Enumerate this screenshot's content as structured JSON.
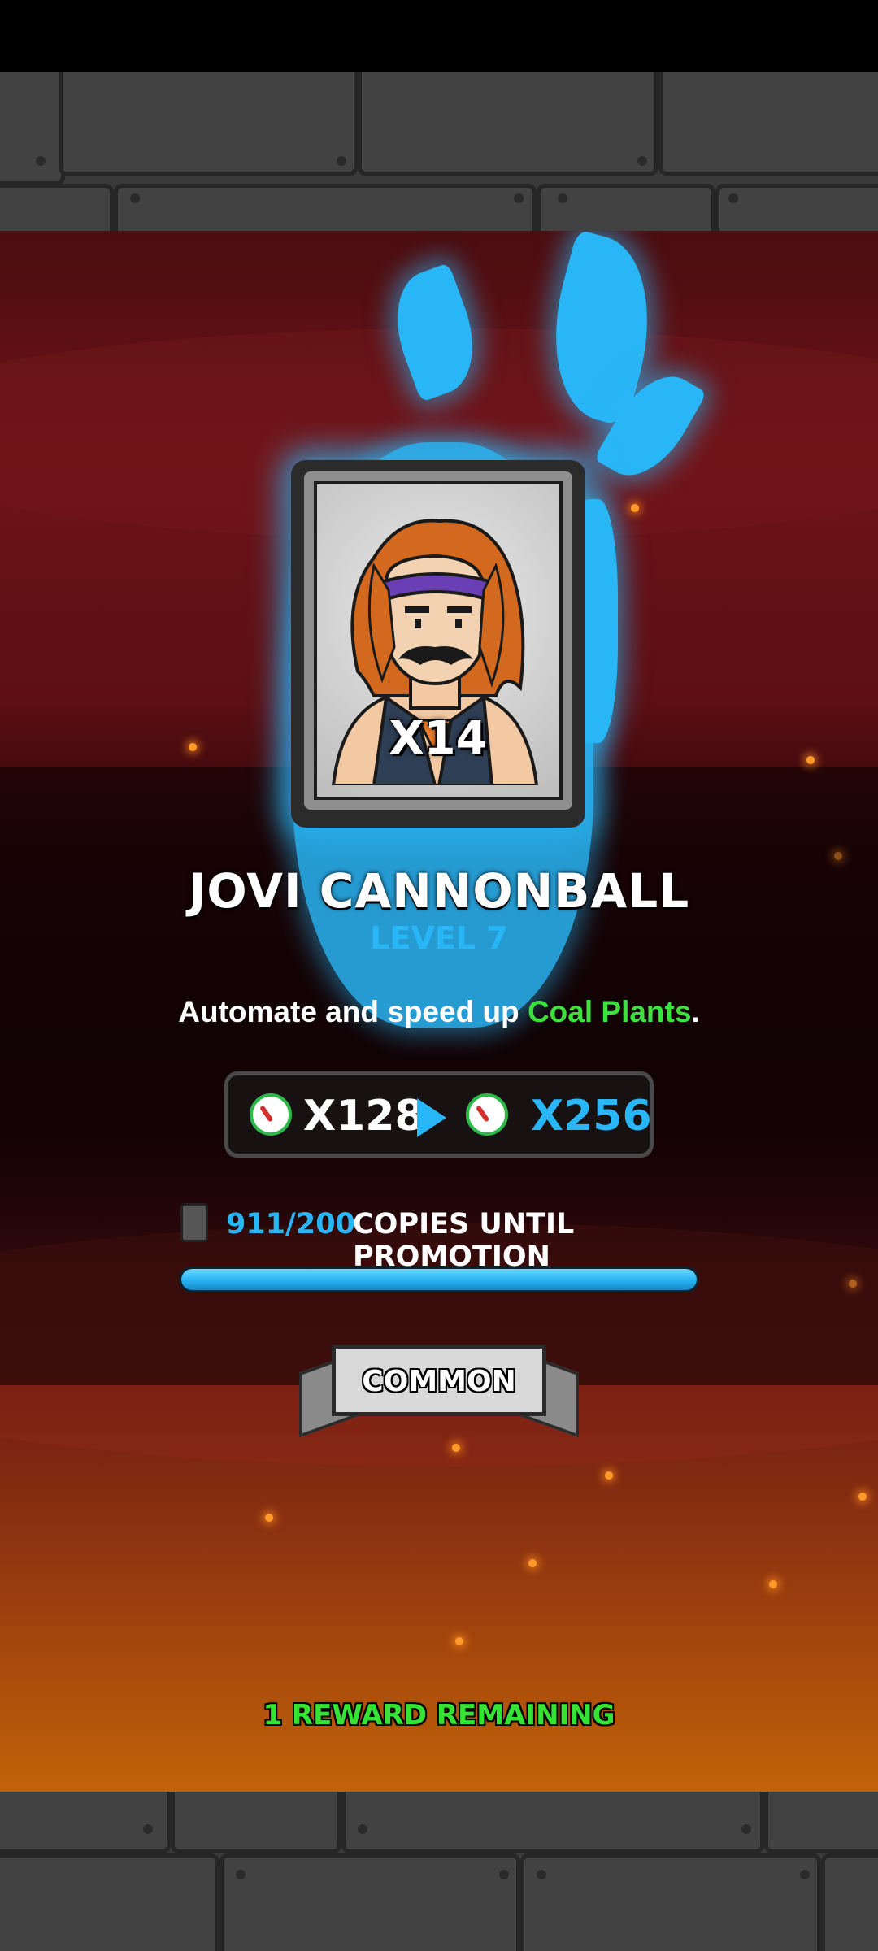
{
  "card": {
    "count": "X14",
    "name": "JOVI CANNONBALL",
    "level": "LEVEL 7",
    "description_prefix": "Automate and speed up ",
    "description_highlight": "Coal Plants",
    "description_suffix": ".",
    "highlight_color": "#3ee03e"
  },
  "boost": {
    "current": "X128",
    "next": "X256",
    "icon": "speed-gauge-icon",
    "arrow_icon": "play-arrow-icon"
  },
  "promotion": {
    "copies": "911/200",
    "label": "COPIES UNTIL PROMOTION",
    "progress": 1.0
  },
  "rarity": {
    "label": "COMMON"
  },
  "rewards": {
    "remaining_text": "1 REWARD REMAINING"
  },
  "colors": {
    "accent_blue": "#29b6f6",
    "accent_green": "#35e335",
    "background_red": "#6e1318",
    "background_orange": "#c26208"
  }
}
